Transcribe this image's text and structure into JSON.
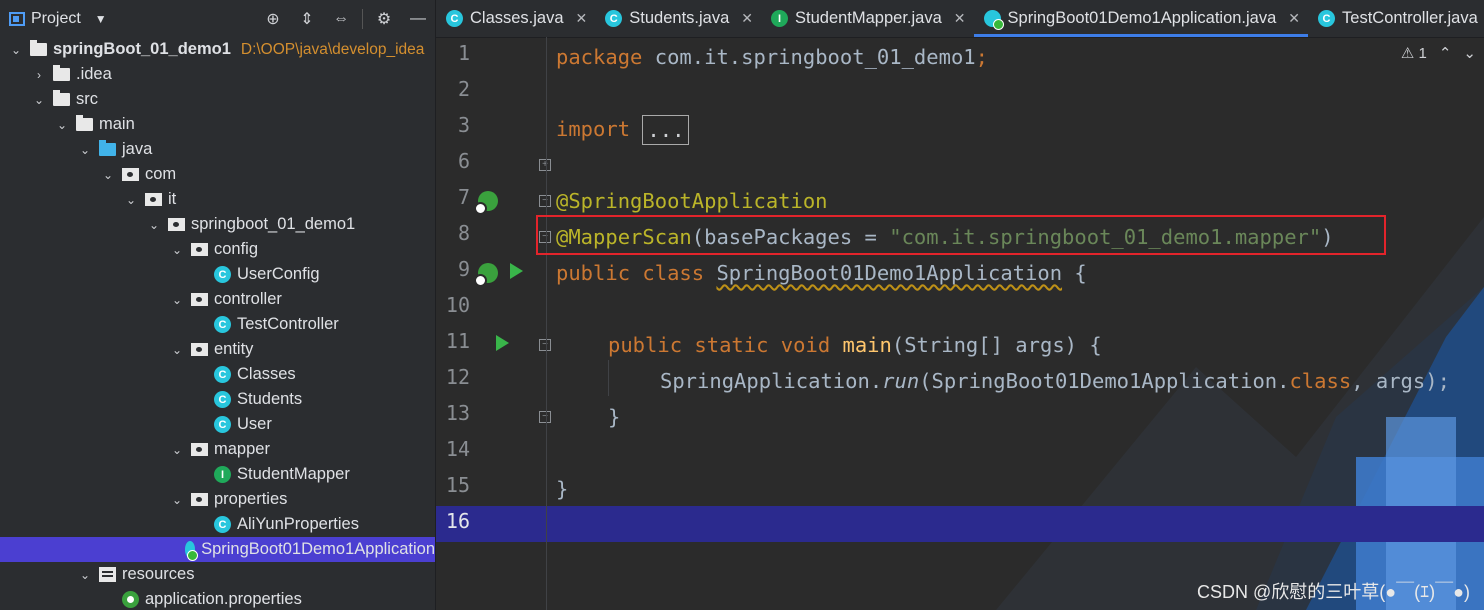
{
  "project_panel": {
    "title": "Project",
    "tools": [
      "⊕",
      "⇕",
      "⇔",
      "⚙",
      "—"
    ]
  },
  "tree": [
    {
      "label": "springBoot_01_demo1",
      "path": "D:\\OOP\\java\\develop_idea",
      "icon": "module",
      "indent": 0,
      "chevron": "⌄",
      "bold": true
    },
    {
      "label": ".idea",
      "icon": "folder",
      "indent": 1,
      "chevron": "›"
    },
    {
      "label": "src",
      "icon": "folder",
      "indent": 1,
      "chevron": "⌄"
    },
    {
      "label": "main",
      "icon": "folder",
      "indent": 2,
      "chevron": "⌄"
    },
    {
      "label": "java",
      "icon": "folder-blue",
      "indent": 3,
      "chevron": "⌄"
    },
    {
      "label": "com",
      "icon": "package",
      "indent": 4,
      "chevron": "⌄"
    },
    {
      "label": "it",
      "icon": "package",
      "indent": 5,
      "chevron": "⌄"
    },
    {
      "label": "springboot_01_demo1",
      "icon": "package",
      "indent": 6,
      "chevron": "⌄"
    },
    {
      "label": "config",
      "icon": "package",
      "indent": 7,
      "chevron": "⌄"
    },
    {
      "label": "UserConfig",
      "icon": "class",
      "indent": 8,
      "chevron": ""
    },
    {
      "label": "controller",
      "icon": "package",
      "indent": 7,
      "chevron": "⌄"
    },
    {
      "label": "TestController",
      "icon": "class",
      "indent": 8,
      "chevron": ""
    },
    {
      "label": "entity",
      "icon": "package",
      "indent": 7,
      "chevron": "⌄"
    },
    {
      "label": "Classes",
      "icon": "class",
      "indent": 8,
      "chevron": ""
    },
    {
      "label": "Students",
      "icon": "class",
      "indent": 8,
      "chevron": ""
    },
    {
      "label": "User",
      "icon": "class",
      "indent": 8,
      "chevron": ""
    },
    {
      "label": "mapper",
      "icon": "package",
      "indent": 7,
      "chevron": "⌄"
    },
    {
      "label": "StudentMapper",
      "icon": "interface",
      "indent": 8,
      "chevron": ""
    },
    {
      "label": "properties",
      "icon": "package",
      "indent": 7,
      "chevron": "⌄"
    },
    {
      "label": "AliYunProperties",
      "icon": "class",
      "indent": 8,
      "chevron": ""
    },
    {
      "label": "SpringBoot01Demo1Application",
      "icon": "app",
      "indent": 7,
      "chevron": "",
      "selected": true
    },
    {
      "label": "resources",
      "icon": "resources",
      "indent": 3,
      "chevron": "⌄"
    },
    {
      "label": "application.properties",
      "icon": "props",
      "indent": 4,
      "chevron": ""
    }
  ],
  "tabs": [
    {
      "label": "Classes.java",
      "icon": "class",
      "close": "✕"
    },
    {
      "label": "Students.java",
      "icon": "class",
      "close": "✕"
    },
    {
      "label": "StudentMapper.java",
      "icon": "interface",
      "close": "✕"
    },
    {
      "label": "SpringBoot01Demo1Application.java",
      "icon": "app",
      "close": "✕",
      "active": true
    },
    {
      "label": "TestController.java",
      "icon": "class",
      "close": ""
    }
  ],
  "inspections": {
    "warning_icon": "⚠",
    "count": "1",
    "up": "⌃",
    "down": "⌄"
  },
  "code": {
    "line_numbers": [
      "1",
      "2",
      "3",
      "6",
      "7",
      "8",
      "9",
      "10",
      "11",
      "12",
      "13",
      "14",
      "15",
      "16"
    ],
    "current_line": "16",
    "kw_package": "package",
    "package_name": " com.it.springboot_01_demo1",
    "semicolon": ";",
    "kw_import": "import",
    "import_fold": "...",
    "ann_springboot": "@SpringBootApplication",
    "ann_mapperscan": "@MapperScan",
    "mapperscan_open": "(basePackages = ",
    "mapperscan_value": "\"com.it.springboot_01_demo1.mapper\"",
    "mapperscan_close": ")",
    "kw_public_class": "public class ",
    "class_name": "SpringBoot01Demo1Application",
    "class_open": " {",
    "kw_main_mods": "public static void ",
    "main_name": "main",
    "main_params": "(String[] args) {",
    "run_target": "SpringApplication.",
    "run_method": "run",
    "run_args_open": "(SpringBoot01Demo1Application.",
    "kw_class": "class",
    "run_args_close": ", args);",
    "brace_close_inner": "}",
    "brace_close_outer": "}"
  },
  "watermark": "CSDN @欣慰的三叶草(●￣(ｴ)￣●)"
}
